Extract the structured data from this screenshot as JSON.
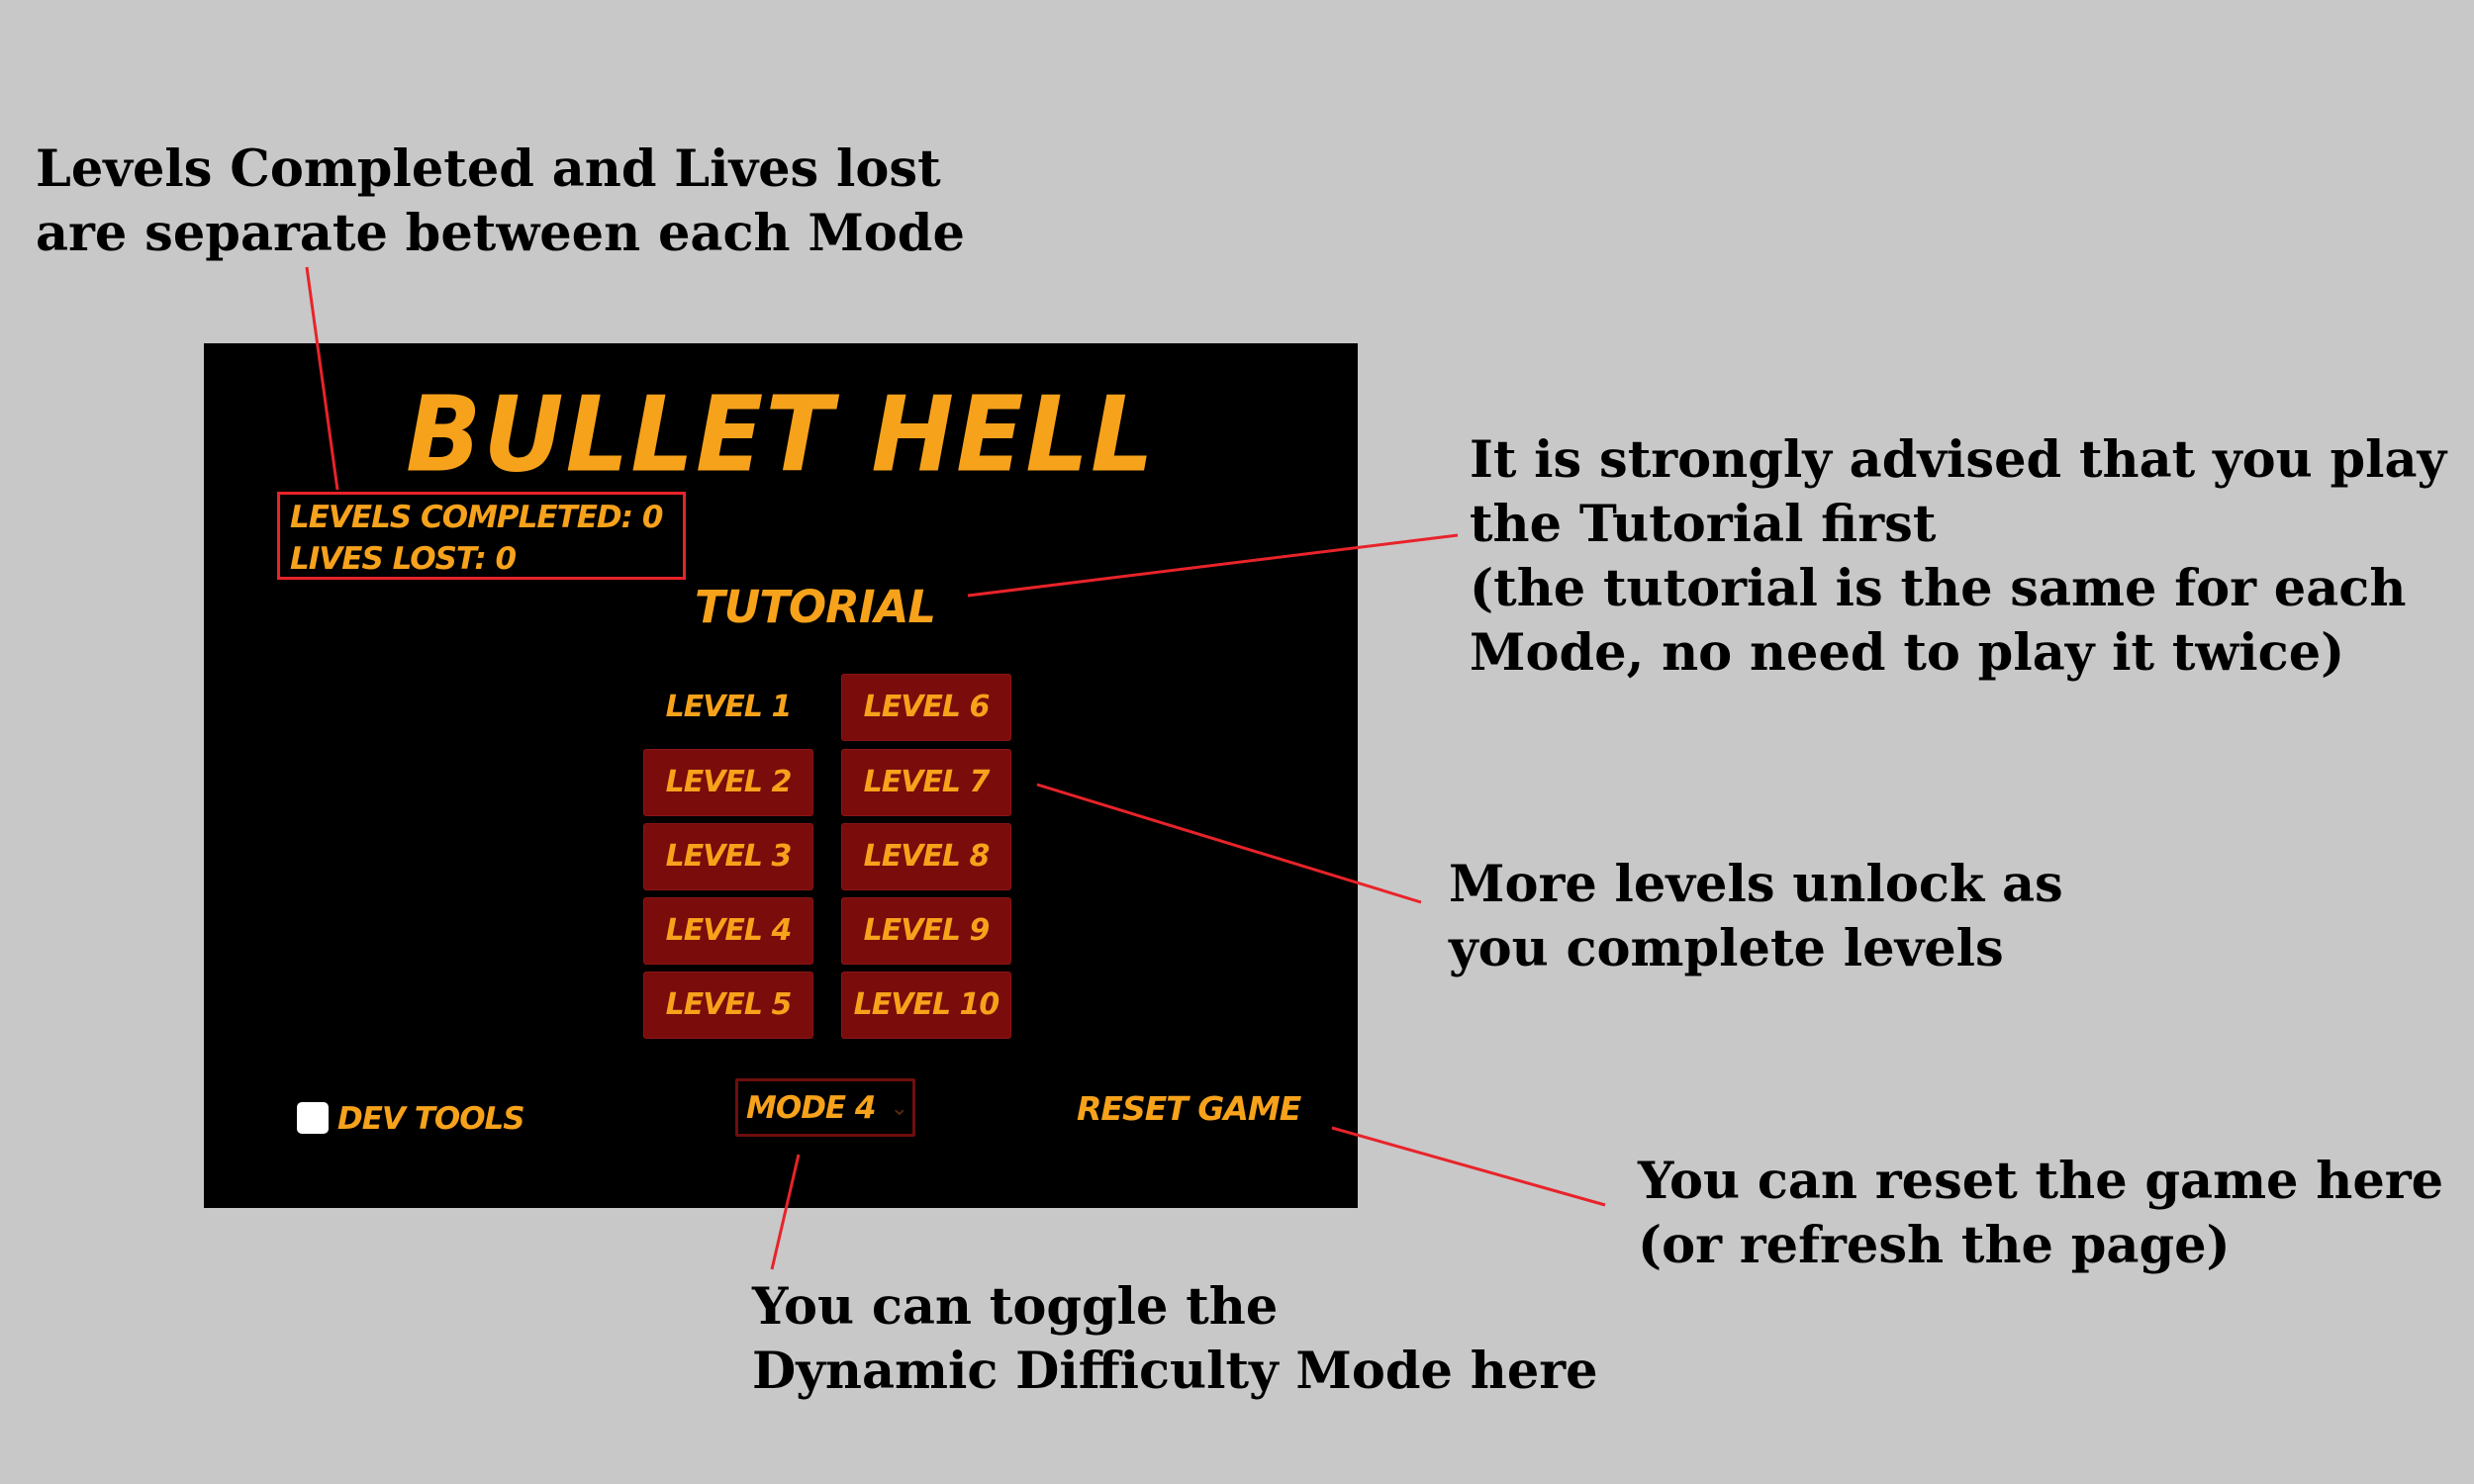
{
  "annotations": {
    "levels_note": "Levels Completed and Lives lost\nare separate between each Mode",
    "tutorial_note": "It is strongly advised that you play\nthe Tutorial first\n(the tutorial is the same for each\nMode, no need to play it twice)",
    "levels_unlock_note": "More levels unlock as\nyou complete levels",
    "reset_note": "You can reset the game here\n(or refresh the page)",
    "mode_note": "You can toggle the\nDynamic Difficulty Mode here"
  },
  "game": {
    "title": "BULLET HELL",
    "levels_completed": "LEVELS COMPLETED: 0",
    "lives_lost": "LIVES LOST: 0",
    "tutorial": "TUTORIAL",
    "levels": [
      {
        "label": "LEVEL 1",
        "locked_style": false
      },
      {
        "label": "LEVEL 2",
        "locked_style": true
      },
      {
        "label": "LEVEL 3",
        "locked_style": true
      },
      {
        "label": "LEVEL 4",
        "locked_style": true
      },
      {
        "label": "LEVEL 5",
        "locked_style": true
      },
      {
        "label": "LEVEL 6",
        "locked_style": true
      },
      {
        "label": "LEVEL 7",
        "locked_style": true
      },
      {
        "label": "LEVEL 8",
        "locked_style": true
      },
      {
        "label": "LEVEL 9",
        "locked_style": true
      },
      {
        "label": "LEVEL 10",
        "locked_style": true
      }
    ],
    "dev_tools_label": "DEV TOOLS",
    "dev_tools_checked": false,
    "mode_selected": "MODE 4",
    "reset_label": "RESET GAME"
  },
  "colors": {
    "background": "#c8c8c8",
    "game_background": "#000000",
    "accent_orange": "#f7a21b",
    "button_red": "#7a0c0c",
    "callout_red": "#e8232a"
  }
}
